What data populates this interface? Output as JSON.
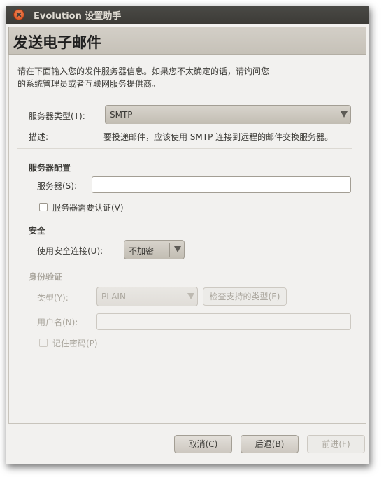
{
  "window": {
    "title": "Evolution 设置助手"
  },
  "page": {
    "title": "发送电子邮件"
  },
  "intro": "请在下面输入您的发件服务器信息。如果您不太确定的话，请询问您的系统管理员或者互联网服务提供商。",
  "server_type": {
    "label": "服务器类型(T):",
    "value": "SMTP"
  },
  "description": {
    "label": "描述:",
    "text": "要投递邮件，应该使用 SMTP 连接到远程的邮件交换服务器。"
  },
  "server_config": {
    "heading": "服务器配置",
    "server_label": "服务器(S):",
    "server_value": "",
    "auth_required_label": "服务器需要认证(V)",
    "auth_required_checked": false
  },
  "security": {
    "heading": "安全",
    "secure_conn_label": "使用安全连接(U):",
    "secure_conn_value": "不加密"
  },
  "authentication": {
    "heading": "身份验证",
    "type_label": "类型(Y):",
    "type_value": "PLAIN",
    "check_types_label": "检查支持的类型(E)",
    "username_label": "用户名(N):",
    "username_value": "",
    "remember_password_label": "记住密码(P)",
    "remember_password_checked": false
  },
  "buttons": {
    "cancel": "取消(C)",
    "back": "后退(B)",
    "forward": "前进(F)"
  }
}
